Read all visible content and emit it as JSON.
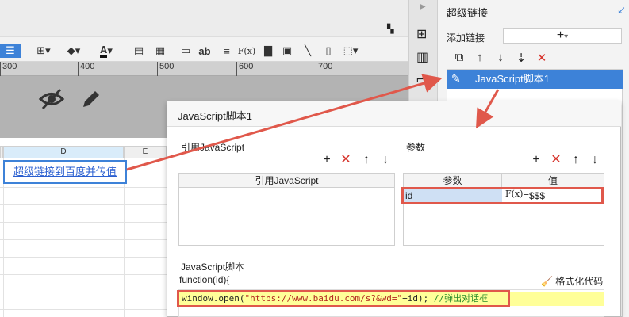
{
  "toolbar": {
    "icons": [
      "align-icon",
      "border-icon",
      "fill-icon",
      "font-color-icon",
      "merge-icon",
      "split-icon",
      "input-icon",
      "text-ab-icon",
      "align-text-icon",
      "formula-icon",
      "chart-icon",
      "image-icon",
      "line-icon",
      "page-icon",
      "frame-icon"
    ],
    "ab_label": "ab",
    "fx_label": "F(x)",
    "font_color_label": "A"
  },
  "ruler": {
    "ticks": [
      "300",
      "400",
      "500",
      "600",
      "700"
    ]
  },
  "sheet": {
    "columns": [
      "D",
      "E"
    ],
    "link_cell_text": "超级链接到百度并传值"
  },
  "panel": {
    "title": "超级链接",
    "add_link_label": "添加链接",
    "add_link_value": "+",
    "items": [
      "JavaScript脚本1"
    ]
  },
  "dialog": {
    "title": "JavaScript脚本1",
    "ref_section_label": "引用JavaScript",
    "ref_column": "引用JavaScript",
    "param_section_label": "参数",
    "param_columns": [
      "参数",
      "值"
    ],
    "params": [
      {
        "name": "id",
        "fx": "F(x)",
        "value": "=$$$"
      }
    ],
    "script_section_label": "JavaScript脚本",
    "function_signature": "function(id){",
    "format_button_label": "格式化代码",
    "code": {
      "prefix": "window.open(",
      "string": "\"https://www.baidu.com/s?&wd=\"",
      "suffix": "+id); ",
      "comment": "//弹出对话框"
    }
  },
  "colors": {
    "accent_blue": "#3d82d8",
    "highlight_red": "#e0584b",
    "code_highlight": "#ffff99"
  }
}
